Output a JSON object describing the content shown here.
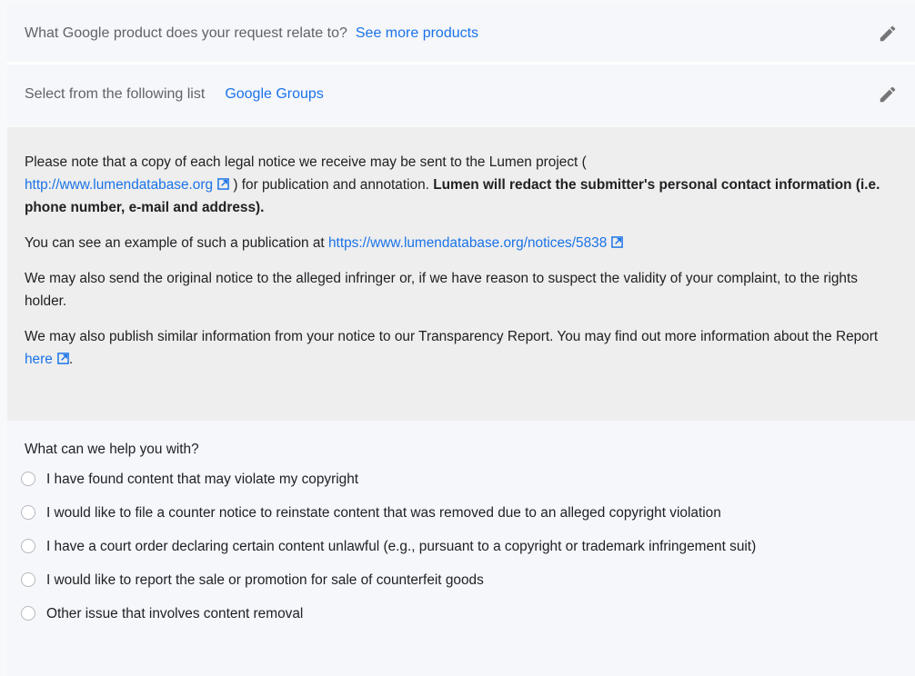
{
  "product_question": {
    "question": "What Google product does your request relate to?",
    "answer": "See more products",
    "edit_icon": "pencil-icon"
  },
  "list_question": {
    "question": "Select from the following list",
    "answer": "Google Groups",
    "edit_icon": "pencil-icon"
  },
  "notice": {
    "p1_text": "Please note that a copy of each legal notice we receive may be sent to the Lumen project (",
    "p1_link": "http://www.lumendatabase.org",
    "p1_after": ") for publication and annotation.",
    "p1_bold": "Lumen will redact the submitter's personal contact information (i.e. phone number, e-mail and address).",
    "p2_text": "You can see an example of such a publication at",
    "p2_link": "https://www.lumendatabase.org/notices/5838",
    "p3_text": "We may also send the original notice to the alleged infringer or, if we have reason to suspect the validity of your complaint, to the rights holder.",
    "p4_text": "We may also publish similar information from your notice to our Transparency Report. You may find out more information about the Report",
    "p4_link": "here",
    "p4_after": ".",
    "external_icon": "external-link-icon"
  },
  "help": {
    "question": "What can we help you with?",
    "options": [
      "I have found content that may violate my copyright",
      "I would like to file a counter notice to reinstate content that was removed due to an alleged copyright violation",
      "I have a court order declaring certain content unlawful (e.g., pursuant to a copyright or trademark infringement suit)",
      "I would like to report the sale or promotion for sale of counterfeit goods",
      "Other issue that involves content removal"
    ]
  },
  "colors": {
    "link": "#1a73e8",
    "row_background": "#f6f7fb",
    "notice_background": "#eeeeee",
    "text": "#202124",
    "muted_text": "#5f6368"
  }
}
